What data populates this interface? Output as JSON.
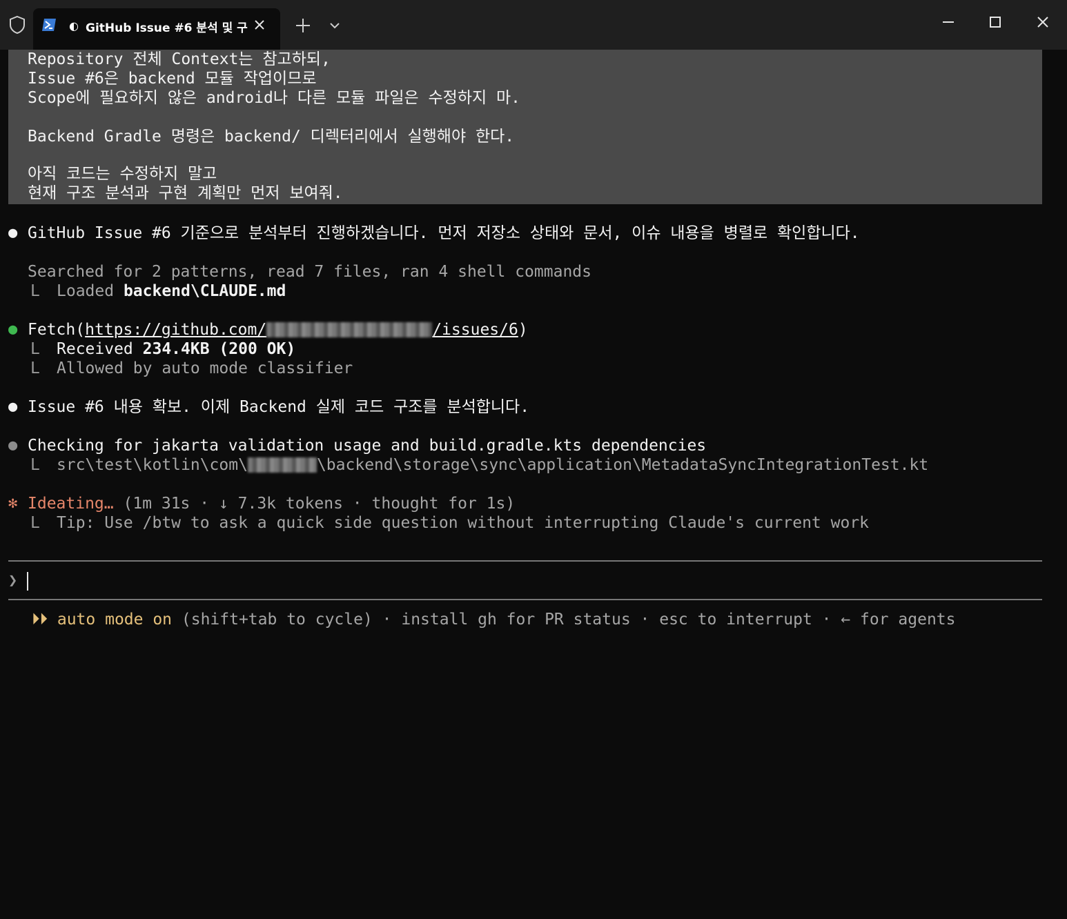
{
  "window": {
    "tab_title": "GitHub Issue #6 분석 및 구",
    "tab_status_glyph": "◐",
    "icons": [
      "shield-icon",
      "powershell-icon",
      "close-icon",
      "plus-icon",
      "chevron-down-icon",
      "minimize-icon",
      "maximize-icon",
      "window-close-icon"
    ]
  },
  "prompt_lines": [
    "Repository 전체 Context는 참고하되,",
    "Issue #6은 backend 모듈 작업이므로",
    "Scope에 필요하지 않은 android나 다른 모듈 파일은 수정하지 마.",
    "",
    "Backend Gradle 명령은 backend/ 디렉터리에서 실행해야 한다.",
    "",
    "아직 코드는 수정하지 말고",
    "현재 구조 분석과 구현 계획만 먼저 보여줘."
  ],
  "messages": {
    "intro": "GitHub Issue #6 기준으로 분석부터 진행하겠습니다. 먼저 저장소 상태와 문서, 이슈 내용을 병렬로 확인합니다.",
    "search_summary": "Searched for 2 patterns, read 7 files, ran 4 shell commands",
    "loaded_prefix": "Loaded ",
    "loaded_file": "backend\\CLAUDE.md",
    "fetch_tool": "Fetch(",
    "fetch_url_prefix": "https://github.com/",
    "fetch_url_suffix": "/issues/6",
    "fetch_close": ")",
    "received_prefix": "Received ",
    "received_value": "234.4KB (200 OK)",
    "allowed": "Allowed by auto mode classifier",
    "issue_ack": "Issue #6 내용 확보. 이제 Backend 실제 코드 구조를 분석합니다.",
    "checking": "Checking for jakarta validation usage and build.gradle.kts dependencies",
    "checking_path_prefix": "src\\test\\kotlin\\com\\",
    "checking_path_suffix": "\\backend\\storage\\sync\\application\\MetadataSyncIntegrationTest.kt",
    "ideating_label": "Ideating…",
    "ideating_stats": " (1m 31s · ↓ 7.3k tokens · thought for 1s)",
    "tip": "Tip: Use /btw to ask a quick side question without interrupting Claude's current work"
  },
  "glyphs": {
    "bullet": "●",
    "tree": "L",
    "spinner": "✻",
    "prompt": "❯",
    "mode": "⏵⏵"
  },
  "status_bar": {
    "mode_label": "auto mode on",
    "rest": " (shift+tab to cycle) · install gh for PR status · esc to interrupt · ← for agents"
  },
  "colors": {
    "background": "#0c0c0c",
    "prompt_block": "#4a4a4a",
    "success_bullet": "#3fb950",
    "spinner": "#e5866a",
    "mode": "#e5c07b"
  }
}
